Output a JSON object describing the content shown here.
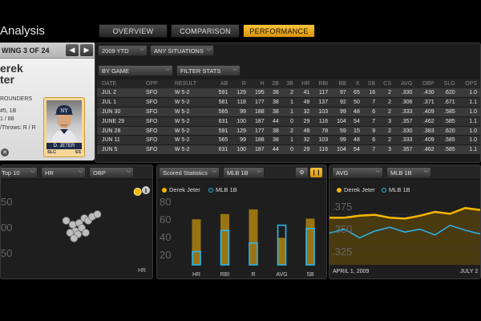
{
  "app": {
    "title": "Analysis"
  },
  "tabs": [
    {
      "label": "OVERVIEW",
      "active": false
    },
    {
      "label": "COMPARISON",
      "active": false
    },
    {
      "label": "PERFORMANCE",
      "active": true
    }
  ],
  "player": {
    "count_label": "WING 3 OF 24",
    "first_name": "erek",
    "last_name": "ter",
    "info_lines": [
      "ROUNDERS",
      "#5, 1B",
      "1 / 88",
      "/Throws: R / R"
    ],
    "card": {
      "name": "D. JETER",
      "team": "SLC",
      "position": "SS"
    }
  },
  "filters": {
    "season": "2009 YTD",
    "situation": "ANY SITUATIONS",
    "grouping": "BY GAME",
    "filter_stats": "FILTER STATS"
  },
  "stats_table": {
    "headers": [
      "DATE",
      "OPP",
      "RESULT",
      "AB",
      "R",
      "H",
      "2B",
      "3B",
      "HR",
      "RBI",
      "BB",
      "K",
      "SB",
      "CS",
      "AVG",
      "OBP",
      "SLG",
      "OPS"
    ],
    "rows": [
      [
        "JUL 2",
        "SFO",
        "W 5-2",
        "591",
        "129",
        "195",
        "38",
        "2",
        "41",
        "117",
        "97",
        "65",
        "16",
        "2",
        ".330",
        ".430",
        ".620",
        "1.0"
      ],
      [
        "JUL 1",
        "SFO",
        "W 5-2",
        "581",
        "118",
        "177",
        "38",
        "1",
        "49",
        "137",
        "92",
        "50",
        "7",
        "2",
        ".306",
        ".371",
        ".671",
        "1.1"
      ],
      [
        "JUN 30",
        "SFO",
        "W 5-2",
        "565",
        "99",
        "188",
        "38",
        "1",
        "32",
        "103",
        "99",
        "48",
        "6",
        "2",
        ".333",
        ".409",
        ".585",
        "1.0"
      ],
      [
        "JUNE 29",
        "SFO",
        "W 5-2",
        "631",
        "100",
        "187",
        "44",
        "0",
        "29",
        "116",
        "104",
        "54",
        "7",
        "3",
        ".357",
        ".462",
        ".585",
        "1.1"
      ],
      [
        "JUN 28",
        "SFO",
        "W 5-2",
        "591",
        "129",
        "177",
        "38",
        "2",
        "49",
        "78",
        "59",
        "15",
        "9",
        "2",
        ".330",
        ".383",
        ".620",
        "1.0"
      ],
      [
        "JUN 11",
        "SFO",
        "W 5-2",
        "565",
        "99",
        "188",
        "38",
        "1",
        "32",
        "103",
        "99",
        "48",
        "6",
        "2",
        ".333",
        ".409",
        ".585",
        "1.0"
      ],
      [
        "JUN 5",
        "SFO",
        "W 5-2",
        "631",
        "100",
        "187",
        "44",
        "0",
        "29",
        "116",
        "104",
        "54",
        "7",
        "3",
        ".357",
        ".462",
        ".585",
        "1.1"
      ]
    ]
  },
  "scatter_panel": {
    "select_top": "Top 10",
    "select_x": "HR",
    "select_y": "OBP",
    "y_ticks": [
      "50",
      "00",
      "50"
    ],
    "x_label": "HR",
    "highlight_color": "#f5b700",
    "chart_data": {
      "type": "scatter",
      "points": [
        {
          "x": 0.38,
          "y": 0.55
        },
        {
          "x": 0.43,
          "y": 0.5
        },
        {
          "x": 0.48,
          "y": 0.52
        },
        {
          "x": 0.52,
          "y": 0.58
        },
        {
          "x": 0.5,
          "y": 0.46
        },
        {
          "x": 0.45,
          "y": 0.42
        },
        {
          "x": 0.41,
          "y": 0.4
        },
        {
          "x": 0.47,
          "y": 0.38
        },
        {
          "x": 0.55,
          "y": 0.55
        },
        {
          "x": 0.58,
          "y": 0.6
        },
        {
          "x": 0.62,
          "y": 0.63
        },
        {
          "x": 0.44,
          "y": 0.33
        },
        {
          "x": 0.53,
          "y": 0.4
        }
      ],
      "highlight": {
        "x": 0.93,
        "y": 0.91
      }
    }
  },
  "bar_panel": {
    "select": "Scored Statistics",
    "select_group": "MLB 1B",
    "legend": [
      {
        "label": "Derek Jeter",
        "color": "#f5b700"
      },
      {
        "label": "MLB 1B",
        "color": "#2ab8f0"
      }
    ],
    "y_ticks": [
      "80",
      "60",
      "40",
      "20"
    ],
    "chart_data": {
      "type": "bar",
      "categories": [
        "HR",
        "RBI",
        "R",
        "AVG",
        "SB"
      ],
      "series": [
        {
          "name": "Derek Jeter",
          "values": [
            69,
            77,
            84,
            41,
            70
          ]
        },
        {
          "name": "MLB 1B",
          "values": [
            20,
            52,
            33,
            60,
            55
          ]
        }
      ],
      "ylim": [
        0,
        90
      ]
    }
  },
  "line_panel": {
    "select_stat": "AVG",
    "select_group": "MLB 1B",
    "legend": [
      {
        "label": "Derek Jeter",
        "color": "#f5b700"
      },
      {
        "label": "MLB 1B",
        "color": "#2ab8f0"
      }
    ],
    "y_ticks": [
      ".375",
      ".350",
      ".325"
    ],
    "x_ticks": [
      "APRIL 1, 2009",
      "JULY 2"
    ],
    "chart_data": {
      "type": "line",
      "x": [
        "APRIL 1, 2009",
        "",
        "",
        "",
        "",
        "",
        "",
        "",
        "",
        "",
        "JULY 2"
      ],
      "series": [
        {
          "name": "Derek Jeter",
          "values": [
            0.364,
            0.364,
            0.366,
            0.367,
            0.364,
            0.363,
            0.366,
            0.37,
            0.368,
            0.374,
            0.372
          ]
        },
        {
          "name": "MLB 1B",
          "values": [
            0.348,
            0.352,
            0.343,
            0.35,
            0.354,
            0.349,
            0.352,
            0.346,
            0.356,
            0.351,
            0.347
          ]
        }
      ],
      "ylim": [
        0.315,
        0.385
      ]
    }
  }
}
